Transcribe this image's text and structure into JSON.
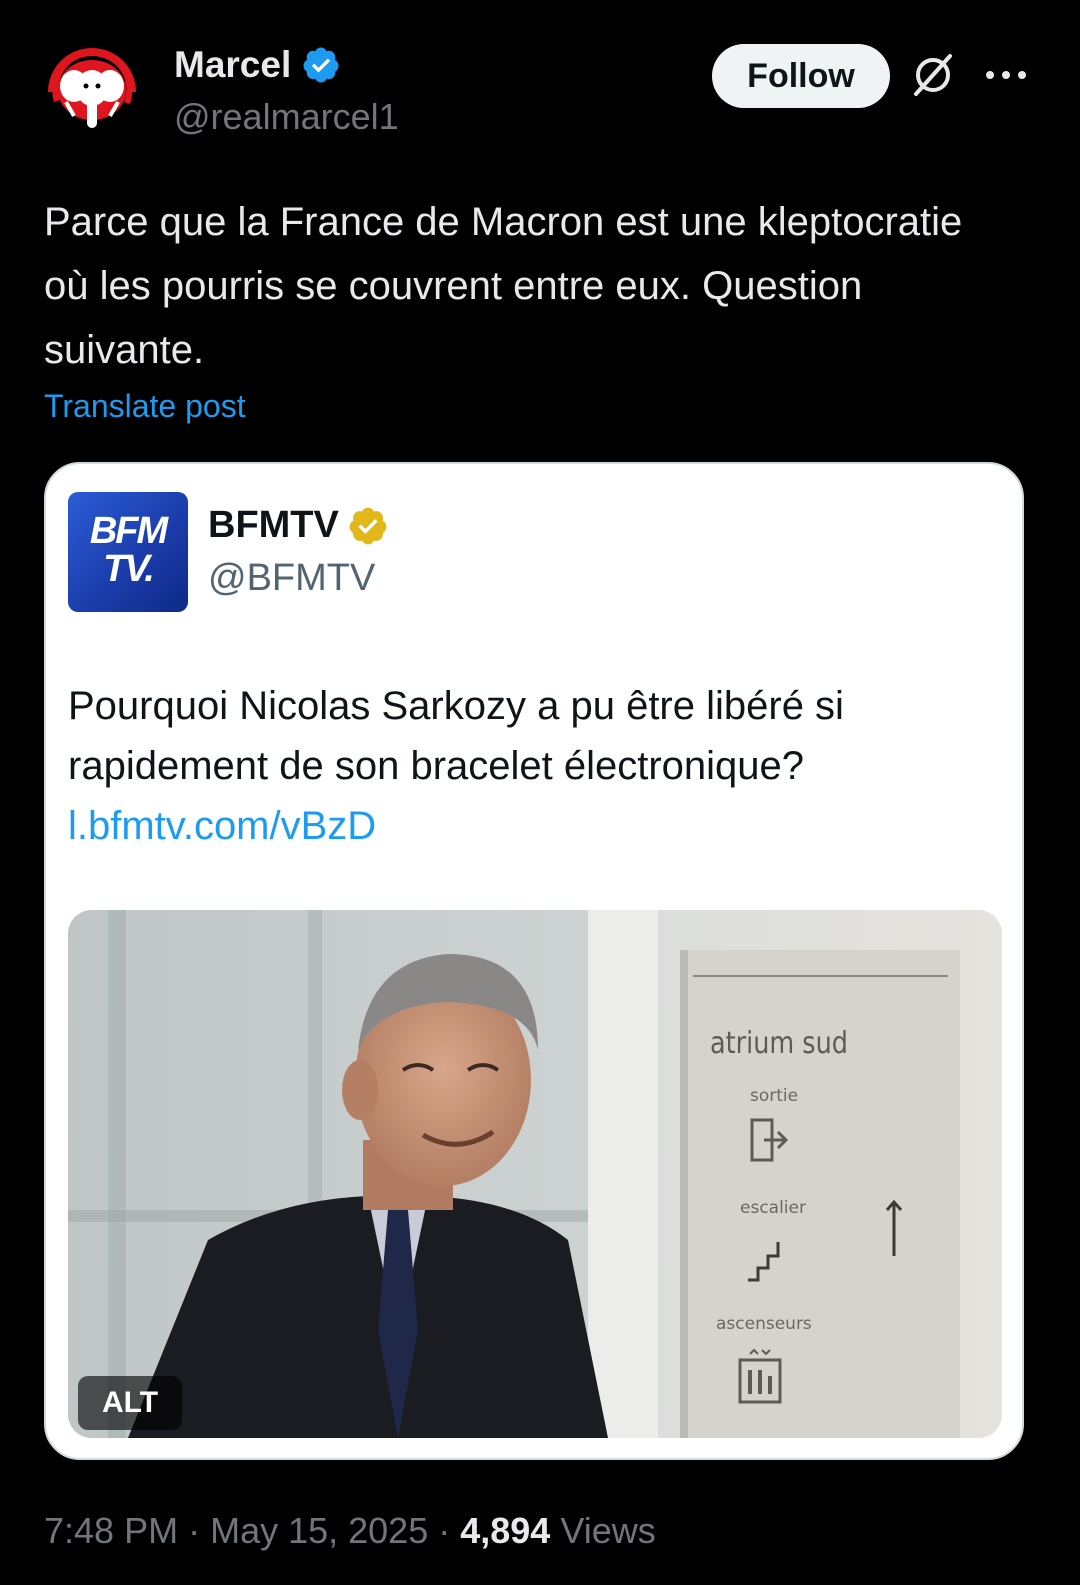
{
  "author": {
    "name": "Marcel",
    "handle": "@realmarcel1"
  },
  "actions": {
    "follow_label": "Follow"
  },
  "tweet": {
    "text": "Parce que la France de Macron est une kleptocratie où les pourris se couvrent entre eux. Question suivante.",
    "translate_label": "Translate post"
  },
  "quote": {
    "logo_line1": "BFM",
    "logo_line2": "TV.",
    "name": "BFMTV",
    "handle": "@BFMTV",
    "text": "Pourquoi Nicolas Sarkozy a pu être libéré si rapidement de son bracelet électronique?",
    "link": "l.bfmtv.com/vBzD",
    "alt_label": "ALT",
    "sign": {
      "title": "atrium sud",
      "item1": "sortie",
      "item2": "escalier",
      "item3": "ascenseurs"
    }
  },
  "meta": {
    "time": "7:48 PM",
    "sep1": " · ",
    "date": "May 15, 2025",
    "sep2": " · ",
    "views_count": "4,894",
    "views_label": " Views"
  },
  "colors": {
    "background": "#000000",
    "text_primary": "#e7e9ea",
    "text_secondary": "#71767b",
    "link": "#1d9bf0",
    "verified_blue": "#1d9bf0",
    "verified_gold": "#e2b719",
    "avatar_red": "#e0161e"
  },
  "icons": {
    "verified_author": "verified-badge-blue-icon",
    "verified_quote": "verified-badge-gold-icon",
    "grok": "grok-icon",
    "more": "more-dots-icon"
  }
}
